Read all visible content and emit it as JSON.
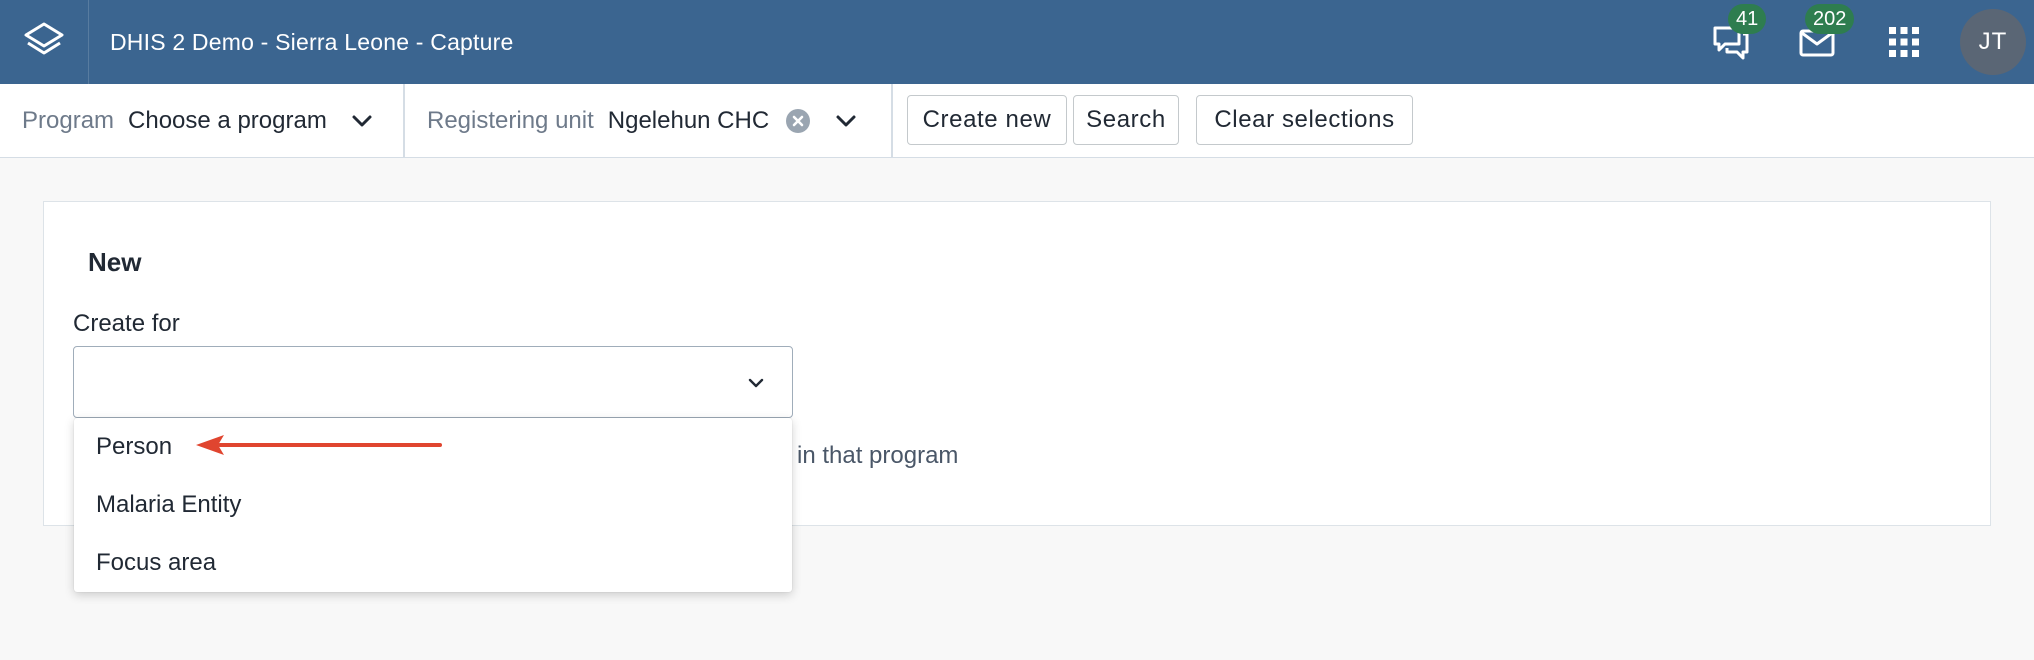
{
  "header": {
    "title": "DHIS 2 Demo - Sierra Leone - Capture",
    "logo_icon": "dhis2-logo-icon",
    "interpretations_count": "41",
    "messages_count": "202",
    "apps_icon": "apps-grid-icon",
    "user_initials": "JT",
    "bg_color": "#3b6590",
    "badge_color": "#2e7d4f"
  },
  "topbar": {
    "program_label": "Program",
    "program_value": "Choose a program",
    "org_unit_label": "Registering unit",
    "org_unit_value": "Ngelehun CHC",
    "create_new": "Create new",
    "search": "Search",
    "clear_selections": "Clear selections"
  },
  "card": {
    "title": "New",
    "create_for_label": "Create for",
    "create_for_value": "",
    "help_text": "in that program"
  },
  "dropdown": {
    "options": [
      "Person",
      "Malaria Entity",
      "Focus area"
    ]
  },
  "annotation": {
    "arrow_color": "#e0452f"
  }
}
